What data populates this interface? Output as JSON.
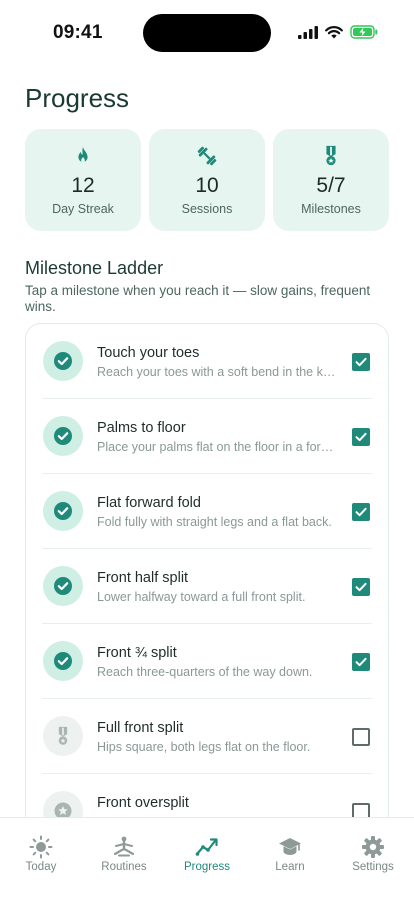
{
  "status_bar": {
    "time": "09:41"
  },
  "header": {
    "title": "Progress"
  },
  "stats": [
    {
      "icon": "flame-icon",
      "value": "12",
      "label": "Day Streak"
    },
    {
      "icon": "dumbbell-icon",
      "value": "10",
      "label": "Sessions"
    },
    {
      "icon": "medal-icon",
      "value": "5/7",
      "label": "Milestones"
    }
  ],
  "ladder": {
    "title": "Milestone Ladder",
    "subtitle": "Tap a milestone when you reach it — slow gains, frequent wins.",
    "items": [
      {
        "title": "Touch your toes",
        "desc": "Reach your toes with a soft bend in the knees.",
        "done": true,
        "icon": "check-circle-icon"
      },
      {
        "title": "Palms to floor",
        "desc": "Place your palms flat on the floor in a forward fold.",
        "done": true,
        "icon": "check-circle-icon"
      },
      {
        "title": "Flat forward fold",
        "desc": "Fold fully with straight legs and a flat back.",
        "done": true,
        "icon": "check-circle-icon"
      },
      {
        "title": "Front half split",
        "desc": "Lower halfway toward a full front split.",
        "done": true,
        "icon": "check-circle-icon"
      },
      {
        "title": "Front ¾ split",
        "desc": "Reach three-quarters of the way down.",
        "done": true,
        "icon": "check-circle-icon"
      },
      {
        "title": "Full front split",
        "desc": "Hips square, both legs flat on the floor.",
        "done": false,
        "icon": "medal-icon"
      },
      {
        "title": "Front oversplit",
        "desc": "",
        "done": false,
        "icon": "star-badge-icon"
      }
    ]
  },
  "tabs": [
    {
      "label": "Today",
      "icon": "sun-icon",
      "active": false
    },
    {
      "label": "Routines",
      "icon": "yoga-icon",
      "active": false
    },
    {
      "label": "Progress",
      "icon": "trend-icon",
      "active": true
    },
    {
      "label": "Learn",
      "icon": "graduation-cap-icon",
      "active": false
    },
    {
      "label": "Settings",
      "icon": "gear-icon",
      "active": false
    }
  ],
  "colors": {
    "accent": "#1f8a7a",
    "card_bg": "#e7f5f1",
    "done_badge": "#cfeee4",
    "battery": "#34c759"
  }
}
